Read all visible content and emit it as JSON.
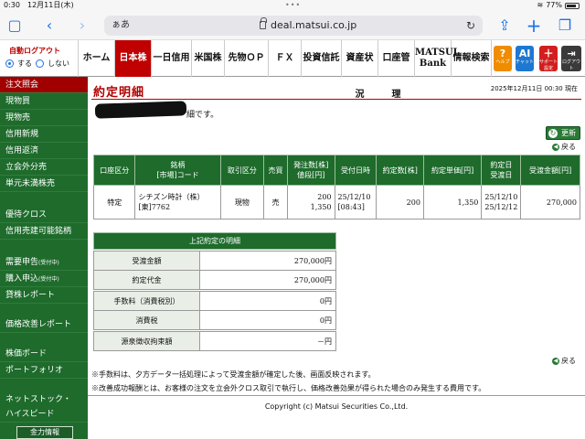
{
  "status": {
    "time": "0:30",
    "date": "12月11日(木)",
    "battery": "77%"
  },
  "browser": {
    "aa": "ぁあ",
    "host": "deal.matsui.co.jp"
  },
  "header": {
    "auto_logout": "自動ログアウト",
    "opt_on": "する",
    "opt_off": "しない",
    "tabs": [
      "ホーム",
      "日本株",
      "一日信用",
      "米国株",
      "先物ＯＰ",
      "ＦＸ",
      "投資信託",
      "資産状況",
      "口座管理",
      "MATSUI",
      "Bank",
      "情報検索"
    ],
    "apps": {
      "help_big": "?",
      "help": "ヘルプ",
      "ai_big": "AI",
      "ai": "チャット",
      "support_big": "＋",
      "support": "サポート\n設定",
      "logout_big": "⇥",
      "logout": "ログアウト"
    }
  },
  "sidebar": {
    "items": [
      "注文照会",
      "現物買",
      "現物売",
      "信用新規",
      "信用返済",
      "立会外分売",
      "単元未満株売",
      "優待クロス",
      "信用売建可能銘柄",
      "需要申告",
      "購入申込",
      "貸株レポート",
      "価格改善レポート",
      "株価ボード",
      "ポートフォリオ",
      "ネットストック・",
      "ハイスピード",
      "金力情報"
    ],
    "sub_label": "(受付中)"
  },
  "main": {
    "title": "約定明細",
    "timestamp": "2025年12月11日 00:30 現在",
    "message": "細です。",
    "refresh": "更新",
    "back": "戻る",
    "order_table": {
      "headers": [
        "口座区分",
        "銘柄",
        "[市場]コード",
        "取引区分",
        "売買",
        "発注数[株]",
        "値段[円]",
        "受付日時",
        "約定数[株]",
        "約定単価[円]",
        "約定日",
        "受渡日",
        "受渡金額[円]"
      ],
      "row": {
        "account": "特定",
        "name": "シチズン時計（株）",
        "code": "[東]7762",
        "trade_type": "現物",
        "side": "売",
        "qty": "200",
        "price": "1,350",
        "recv_date": "25/12/10",
        "recv_time": "[08:43]",
        "exec_qty": "200",
        "exec_price": "1,350",
        "exec_date": "25/12/10",
        "settle_date": "25/12/12",
        "settle_amount": "270,000"
      }
    },
    "summary": {
      "title": "上記約定の明細",
      "rows": [
        {
          "label": "受渡金額",
          "value": "270,000円"
        },
        {
          "label": "約定代金",
          "value": "270,000円"
        },
        {
          "label": "手数料（消費税別）",
          "value": "0円"
        },
        {
          "label": "消費税",
          "value": "0円"
        },
        {
          "label": "源泉徴収拘束額",
          "value": "－円"
        }
      ]
    },
    "notes": [
      "※手数料は、夕方データ一括処理によって受渡金額が確定した後、画面反映されます。",
      "※改善成功報酬とは、お客様の注文を立会外クロス取引で執行し、価格改善効果が得られた場合のみ発生する費用です。"
    ],
    "copyright": "Copyright (c) Matsui Securities Co.,Ltd."
  },
  "colors": {
    "brand_green": "#1e6b2c",
    "brand_red": "#b00000",
    "ios_blue": "#1a73e8"
  }
}
